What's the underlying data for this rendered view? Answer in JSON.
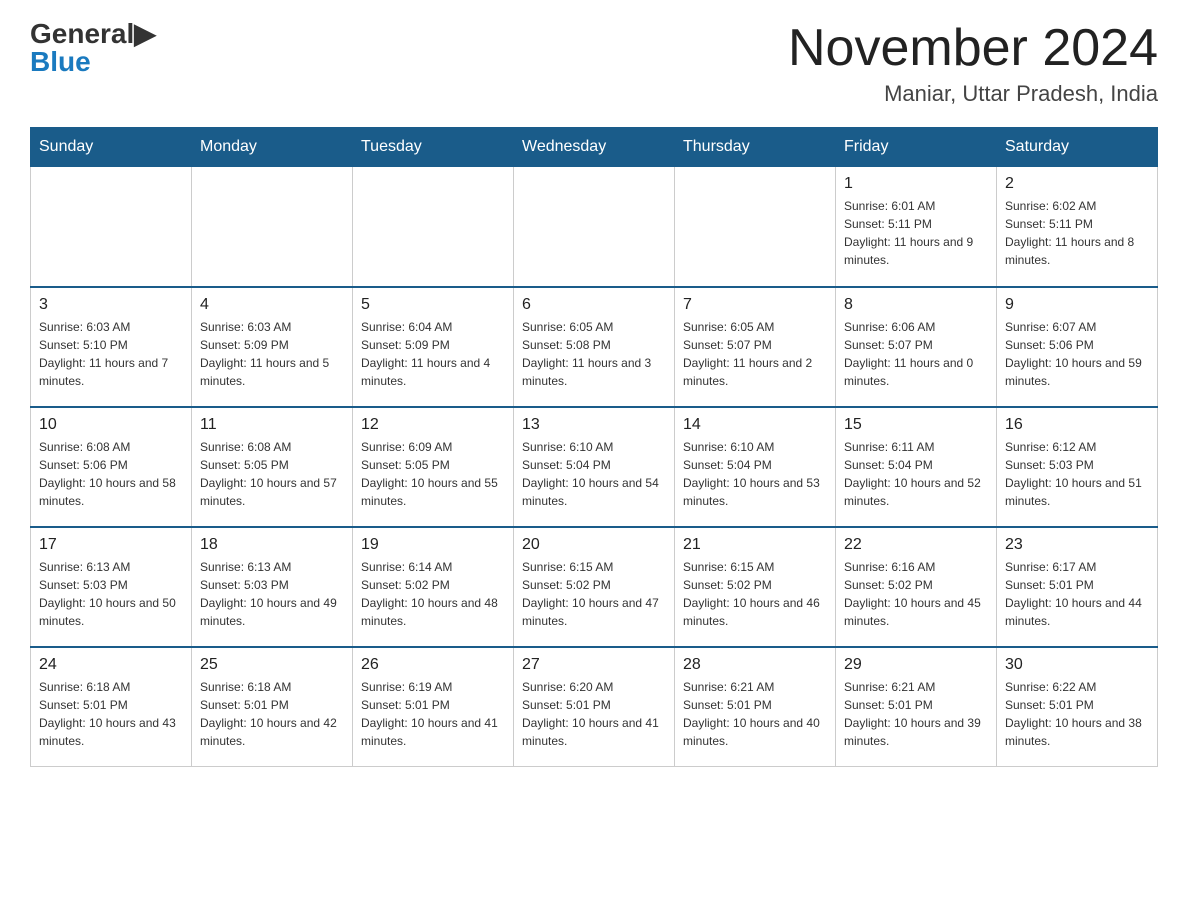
{
  "header": {
    "logo_general": "General",
    "logo_blue": "Blue",
    "month_year": "November 2024",
    "location": "Maniar, Uttar Pradesh, India"
  },
  "days_of_week": [
    "Sunday",
    "Monday",
    "Tuesday",
    "Wednesday",
    "Thursday",
    "Friday",
    "Saturday"
  ],
  "weeks": [
    [
      {
        "day": "",
        "info": ""
      },
      {
        "day": "",
        "info": ""
      },
      {
        "day": "",
        "info": ""
      },
      {
        "day": "",
        "info": ""
      },
      {
        "day": "",
        "info": ""
      },
      {
        "day": "1",
        "info": "Sunrise: 6:01 AM\nSunset: 5:11 PM\nDaylight: 11 hours and 9 minutes."
      },
      {
        "day": "2",
        "info": "Sunrise: 6:02 AM\nSunset: 5:11 PM\nDaylight: 11 hours and 8 minutes."
      }
    ],
    [
      {
        "day": "3",
        "info": "Sunrise: 6:03 AM\nSunset: 5:10 PM\nDaylight: 11 hours and 7 minutes."
      },
      {
        "day": "4",
        "info": "Sunrise: 6:03 AM\nSunset: 5:09 PM\nDaylight: 11 hours and 5 minutes."
      },
      {
        "day": "5",
        "info": "Sunrise: 6:04 AM\nSunset: 5:09 PM\nDaylight: 11 hours and 4 minutes."
      },
      {
        "day": "6",
        "info": "Sunrise: 6:05 AM\nSunset: 5:08 PM\nDaylight: 11 hours and 3 minutes."
      },
      {
        "day": "7",
        "info": "Sunrise: 6:05 AM\nSunset: 5:07 PM\nDaylight: 11 hours and 2 minutes."
      },
      {
        "day": "8",
        "info": "Sunrise: 6:06 AM\nSunset: 5:07 PM\nDaylight: 11 hours and 0 minutes."
      },
      {
        "day": "9",
        "info": "Sunrise: 6:07 AM\nSunset: 5:06 PM\nDaylight: 10 hours and 59 minutes."
      }
    ],
    [
      {
        "day": "10",
        "info": "Sunrise: 6:08 AM\nSunset: 5:06 PM\nDaylight: 10 hours and 58 minutes."
      },
      {
        "day": "11",
        "info": "Sunrise: 6:08 AM\nSunset: 5:05 PM\nDaylight: 10 hours and 57 minutes."
      },
      {
        "day": "12",
        "info": "Sunrise: 6:09 AM\nSunset: 5:05 PM\nDaylight: 10 hours and 55 minutes."
      },
      {
        "day": "13",
        "info": "Sunrise: 6:10 AM\nSunset: 5:04 PM\nDaylight: 10 hours and 54 minutes."
      },
      {
        "day": "14",
        "info": "Sunrise: 6:10 AM\nSunset: 5:04 PM\nDaylight: 10 hours and 53 minutes."
      },
      {
        "day": "15",
        "info": "Sunrise: 6:11 AM\nSunset: 5:04 PM\nDaylight: 10 hours and 52 minutes."
      },
      {
        "day": "16",
        "info": "Sunrise: 6:12 AM\nSunset: 5:03 PM\nDaylight: 10 hours and 51 minutes."
      }
    ],
    [
      {
        "day": "17",
        "info": "Sunrise: 6:13 AM\nSunset: 5:03 PM\nDaylight: 10 hours and 50 minutes."
      },
      {
        "day": "18",
        "info": "Sunrise: 6:13 AM\nSunset: 5:03 PM\nDaylight: 10 hours and 49 minutes."
      },
      {
        "day": "19",
        "info": "Sunrise: 6:14 AM\nSunset: 5:02 PM\nDaylight: 10 hours and 48 minutes."
      },
      {
        "day": "20",
        "info": "Sunrise: 6:15 AM\nSunset: 5:02 PM\nDaylight: 10 hours and 47 minutes."
      },
      {
        "day": "21",
        "info": "Sunrise: 6:15 AM\nSunset: 5:02 PM\nDaylight: 10 hours and 46 minutes."
      },
      {
        "day": "22",
        "info": "Sunrise: 6:16 AM\nSunset: 5:02 PM\nDaylight: 10 hours and 45 minutes."
      },
      {
        "day": "23",
        "info": "Sunrise: 6:17 AM\nSunset: 5:01 PM\nDaylight: 10 hours and 44 minutes."
      }
    ],
    [
      {
        "day": "24",
        "info": "Sunrise: 6:18 AM\nSunset: 5:01 PM\nDaylight: 10 hours and 43 minutes."
      },
      {
        "day": "25",
        "info": "Sunrise: 6:18 AM\nSunset: 5:01 PM\nDaylight: 10 hours and 42 minutes."
      },
      {
        "day": "26",
        "info": "Sunrise: 6:19 AM\nSunset: 5:01 PM\nDaylight: 10 hours and 41 minutes."
      },
      {
        "day": "27",
        "info": "Sunrise: 6:20 AM\nSunset: 5:01 PM\nDaylight: 10 hours and 41 minutes."
      },
      {
        "day": "28",
        "info": "Sunrise: 6:21 AM\nSunset: 5:01 PM\nDaylight: 10 hours and 40 minutes."
      },
      {
        "day": "29",
        "info": "Sunrise: 6:21 AM\nSunset: 5:01 PM\nDaylight: 10 hours and 39 minutes."
      },
      {
        "day": "30",
        "info": "Sunrise: 6:22 AM\nSunset: 5:01 PM\nDaylight: 10 hours and 38 minutes."
      }
    ]
  ]
}
